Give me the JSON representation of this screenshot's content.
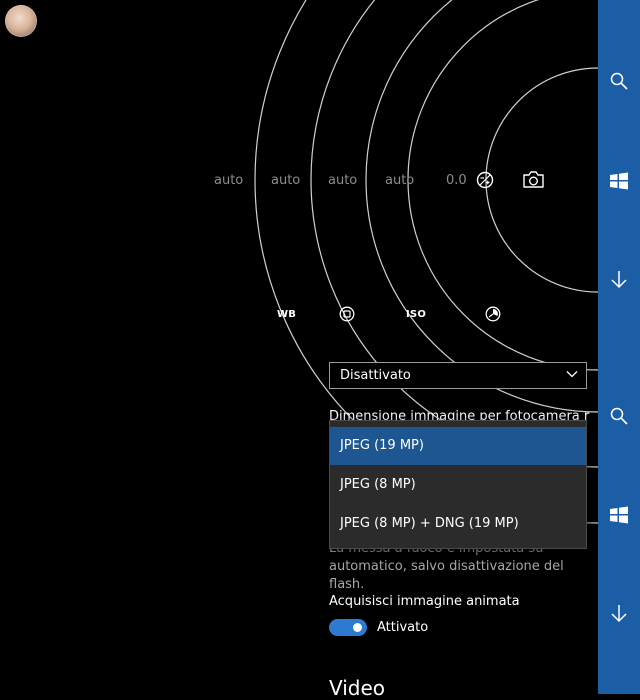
{
  "dial": {
    "values": [
      "auto",
      "auto",
      "auto",
      "auto",
      "0.0"
    ],
    "labels": [
      "WB",
      "ISO"
    ]
  },
  "settings": {
    "flash_mode_value": "Disattivato",
    "image_size_label": "Dimensione immagine per fotocamera r",
    "image_size_options": [
      "JPEG (19 MP)",
      "JPEG (8 MP)",
      "JPEG (8 MP) + DNG (19 MP)"
    ],
    "selected_option": "JPEG (19 MP)",
    "focus_description_line1": "La messa a fuoco è impostata su",
    "focus_description_line2": "automatico, salvo disattivazione del flash.",
    "animated_image_label": "Acquisisci immagine animata",
    "animated_image_state": "Attivato",
    "video_heading": "Video"
  },
  "sidebar": {
    "icons": [
      "search-icon",
      "windows-icon",
      "down-arrow-icon",
      "search-icon",
      "windows-icon",
      "down-arrow-icon"
    ]
  },
  "colors": {
    "accent": "#1b5ea5",
    "selected_option": "#1d5690",
    "toggle": "#2d7ad0"
  }
}
